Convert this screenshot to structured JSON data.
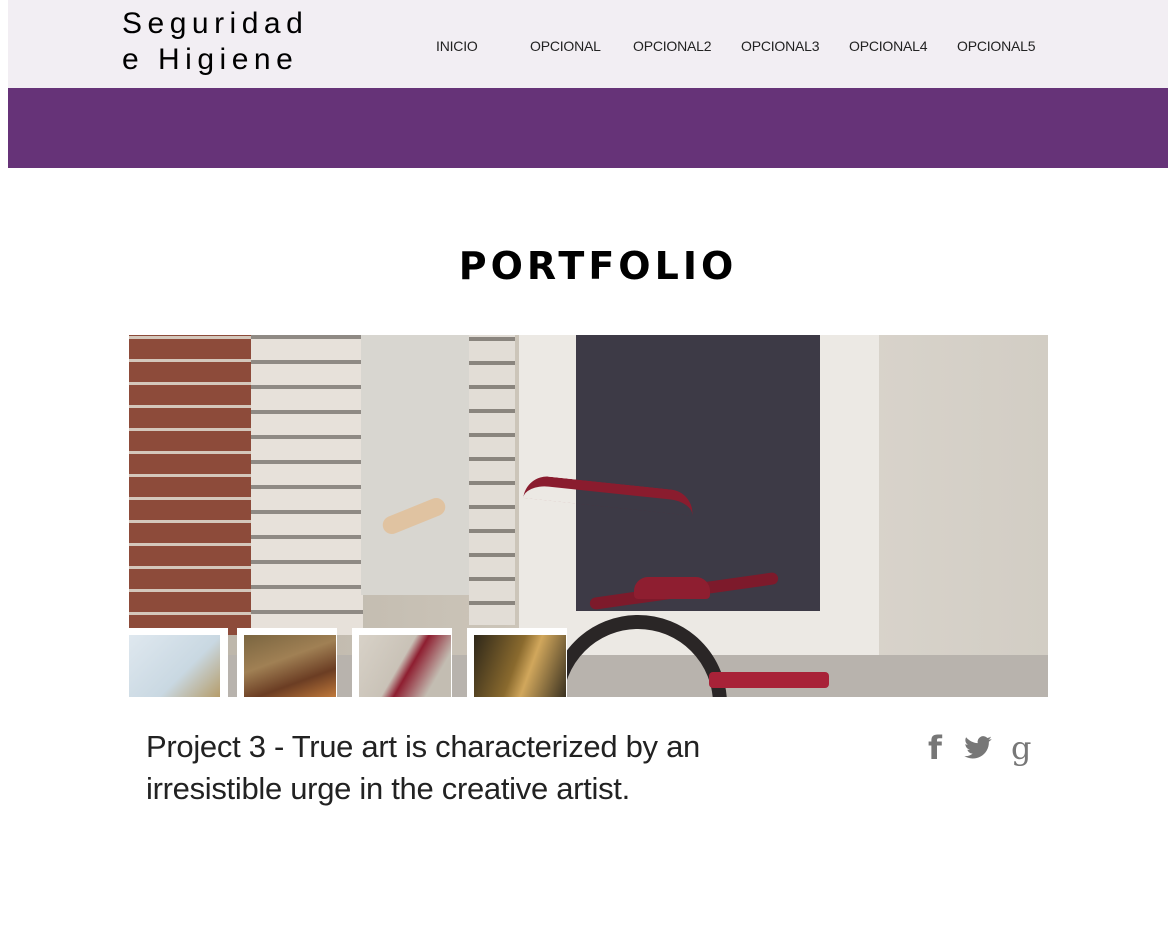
{
  "header": {
    "logo_line1": "Seguridad",
    "logo_line2": "e Higiene",
    "nav": [
      "INICIO",
      "OPCIONAL",
      "OPCIONAL2",
      "OPCIONAL3",
      "OPCIONAL4",
      "OPCIONAL5"
    ]
  },
  "colors": {
    "header_bg": "#f2eef3",
    "band": "#663378",
    "social": "#777777"
  },
  "portfolio": {
    "title": "PORTFOLIO",
    "caption": "Project 3 - True art is characterized by an irresistible urge in the creative artist.",
    "slide_icon": "tricycle-photo",
    "thumbnails": [
      "sculpture-thumbnail",
      "log-thumbnail",
      "tricycle-thumbnail",
      "corridor-thumbnail"
    ]
  },
  "social": {
    "facebook": "f",
    "twitter": "twitter-bird-icon",
    "google": "g"
  }
}
